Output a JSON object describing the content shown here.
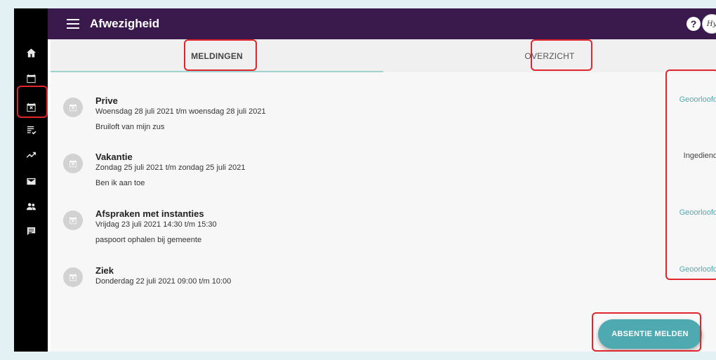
{
  "header": {
    "title": "Afwezigheid",
    "help_label": "?",
    "avatar_text": "Hy"
  },
  "sidebar": {
    "items": [
      {
        "icon": "home-icon"
      },
      {
        "icon": "calendar-icon"
      },
      {
        "icon": "calendar-absence-icon"
      },
      {
        "icon": "checklist-icon"
      },
      {
        "icon": "trending-up-icon"
      },
      {
        "icon": "mail-icon"
      },
      {
        "icon": "people-icon"
      },
      {
        "icon": "chat-icon"
      }
    ]
  },
  "tabs": [
    {
      "label": "MELDINGEN"
    },
    {
      "label": "OVERZICHT"
    }
  ],
  "absences": [
    {
      "title": "Prive",
      "date": "Woensdag 28 juli 2021 t/m woensdag 28 juli 2021",
      "description": "Bruiloft van mijn zus",
      "status": "Geoorloofd"
    },
    {
      "title": "Vakantie",
      "date": "Zondag 25 juli 2021 t/m zondag 25 juli 2021",
      "description": "Ben ik aan toe",
      "status": "Ingediend"
    },
    {
      "title": "Afspraken met instanties",
      "date": "Vrijdag 23 juli 2021 14:30 t/m 15:30",
      "description": "paspoort ophalen bij gemeente",
      "status": "Geoorloofd"
    },
    {
      "title": "Ziek",
      "date": "Donderdag 22 juli 2021 09:00 t/m 10:00",
      "description": "",
      "status": "Geoorloofd"
    }
  ],
  "fab": {
    "label": "ABSENTIE MELDEN"
  },
  "colors": {
    "header": "#3a1a4d",
    "accent": "#4fa9b0",
    "highlight": "#e0262a"
  }
}
